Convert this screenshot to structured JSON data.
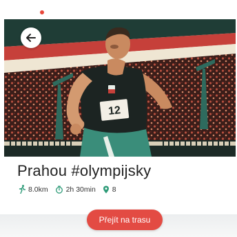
{
  "route": {
    "title": "Prahou #olympijsky",
    "stats": {
      "distance": "8.0km",
      "duration": "2h 30min",
      "stops": "8"
    }
  },
  "actions": {
    "start_label": "Přejít na trasu"
  },
  "hero": {
    "jersey_number": "12"
  },
  "icons": {
    "back": "arrow-left-icon",
    "distance": "running-figure-icon",
    "duration": "stopwatch-icon",
    "stops": "map-pin-icon"
  },
  "colors": {
    "accent": "#e34b43",
    "stat_icon": "#2e9b78",
    "title_text": "#222222"
  }
}
